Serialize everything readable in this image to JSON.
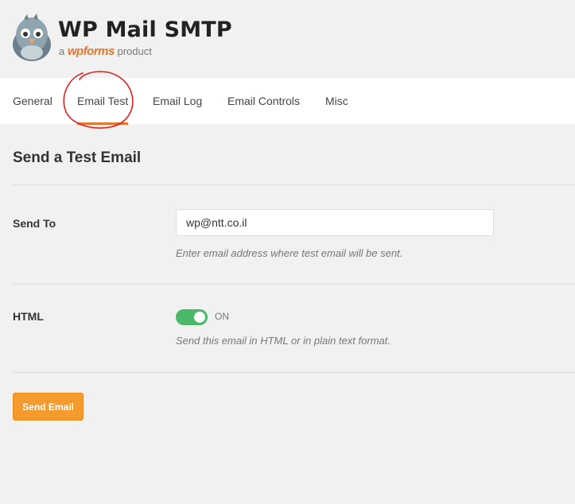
{
  "header": {
    "title": "WP Mail SMTP",
    "subtitle_prefix": "a",
    "subtitle_brand": "wpforms",
    "subtitle_suffix": "product"
  },
  "nav": {
    "tabs": [
      {
        "label": "General"
      },
      {
        "label": "Email Test"
      },
      {
        "label": "Email Log"
      },
      {
        "label": "Email Controls"
      },
      {
        "label": "Misc"
      }
    ],
    "active": "Email Test"
  },
  "main": {
    "title": "Send a Test Email",
    "send_to": {
      "label": "Send To",
      "value": "wp@ntt.co.il",
      "help": "Enter email address where test email will be sent."
    },
    "html": {
      "label": "HTML",
      "toggle_state": "ON",
      "help": "Send this email in HTML or in plain text format."
    },
    "submit_label": "Send Email"
  },
  "colors": {
    "accent": "#e27730",
    "button": "#f59a2c",
    "toggle_on": "#4ab866",
    "annotation": "#e02020"
  }
}
